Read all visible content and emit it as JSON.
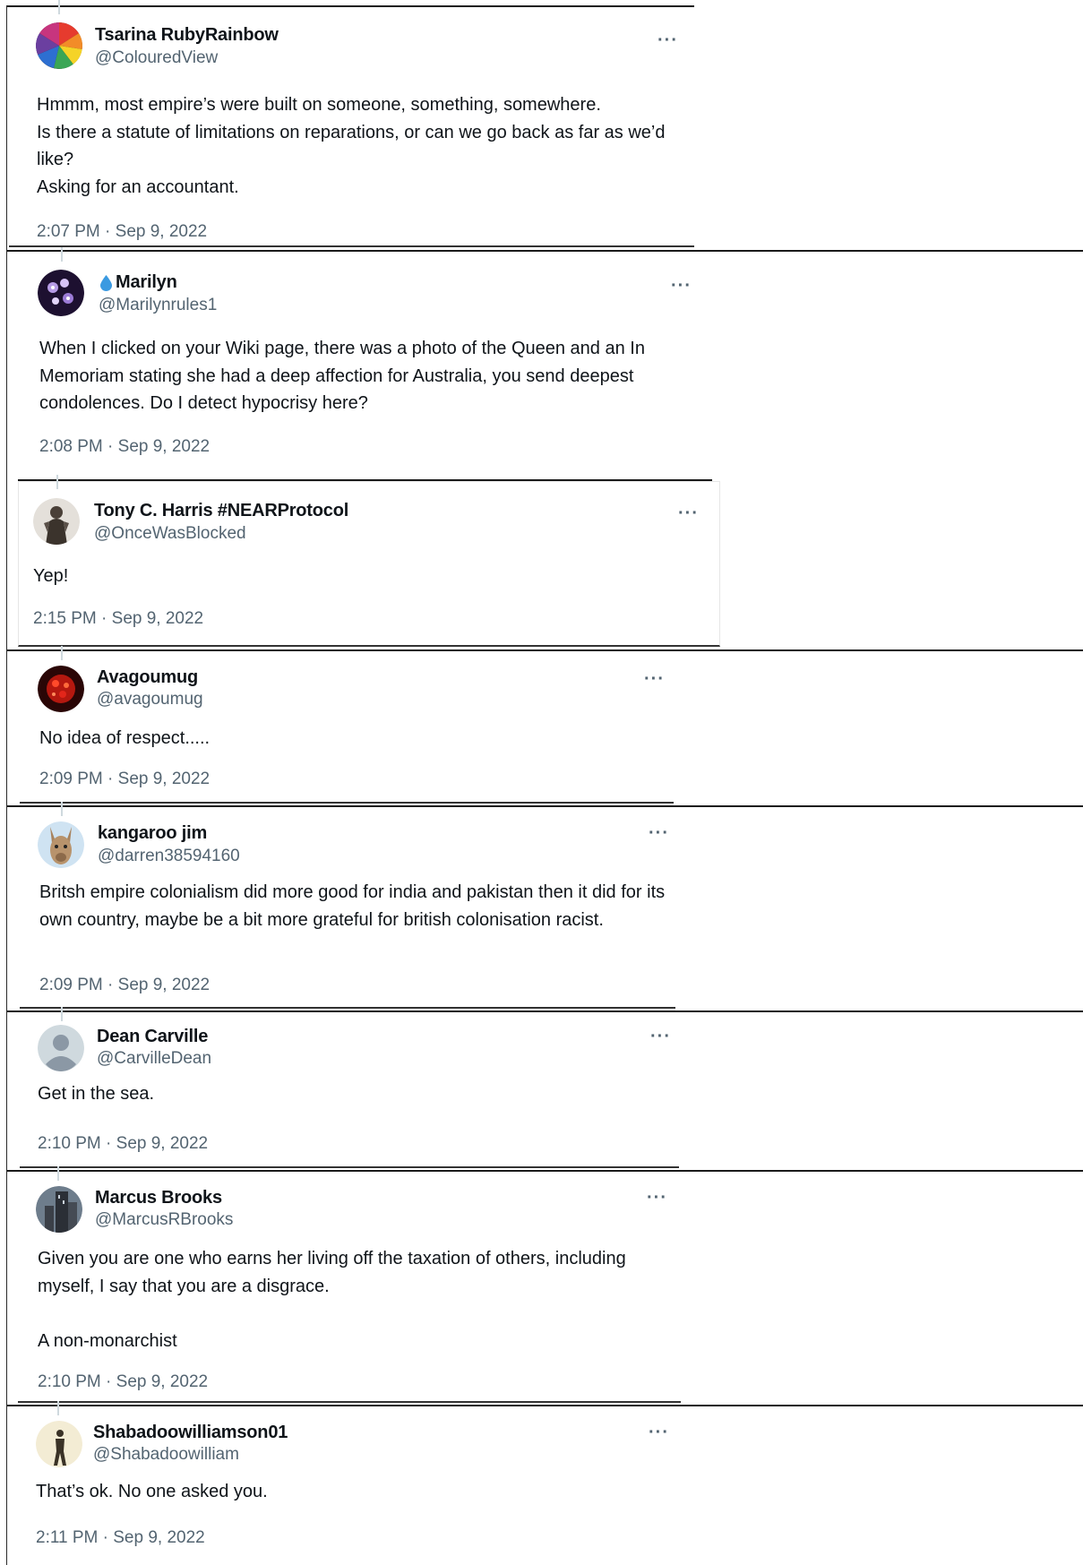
{
  "tweets": [
    {
      "name": "Tsarina RubyRainbow",
      "handle": "@ColouredView",
      "text": "Hmmm, most empire’s were built on someone, something, somewhere.\nIs there a statute of limitations on reparations, or can we go back as far as we’d like?\nAsking for an accountant.",
      "time": "2:07 PM · Sep 9, 2022",
      "more": "···"
    },
    {
      "name": "Marilyn",
      "handle": "@Marilynrules1",
      "text": "When I clicked on your Wiki page, there was a photo of the Queen and an In Memoriam stating she had a deep affection for Australia, you send deepest condolences. Do I detect hypocrisy here?",
      "time": "2:08 PM · Sep 9, 2022",
      "more": "···",
      "name_icon": "water-drop-icon"
    },
    {
      "name": "Tony C. Harris #NEARProtocol",
      "handle": "@OnceWasBlocked",
      "text": "Yep!",
      "time": "2:15 PM · Sep 9, 2022",
      "more": "···"
    },
    {
      "name": "Avagoumug",
      "handle": "@avagoumug",
      "text": "No idea of respect.....",
      "time": "2:09 PM · Sep 9, 2022",
      "more": "···"
    },
    {
      "name": "kangaroo jim",
      "handle": "@darren38594160",
      "text": "Britsh empire colonialism did more good for india and pakistan then it did for its own country, maybe be a bit more grateful for british colonisation racist.",
      "time": "2:09 PM · Sep 9, 2022",
      "more": "···"
    },
    {
      "name": "Dean Carville",
      "handle": "@CarvilleDean",
      "text": "Get in the sea.",
      "time": "2:10 PM · Sep 9, 2022",
      "more": "···"
    },
    {
      "name": "Marcus Brooks",
      "handle": "@MarcusRBrooks",
      "text": "Given you are one who earns her living off the taxation of others, including myself, I say that you are a disgrace.\n\nA non-monarchist",
      "time": "2:10 PM · Sep 9, 2022",
      "more": "···"
    },
    {
      "name": "Shabadoowilliamson01",
      "handle": "@Shabadoowilliam",
      "text": "That’s ok. No one asked you.",
      "time": "2:11 PM · Sep 9, 2022",
      "more": "···"
    }
  ],
  "colors": {
    "text": "#0f1419",
    "secondary": "#536471",
    "drop_icon": "#3b9ae1",
    "thread_line": "#cfd9de"
  }
}
